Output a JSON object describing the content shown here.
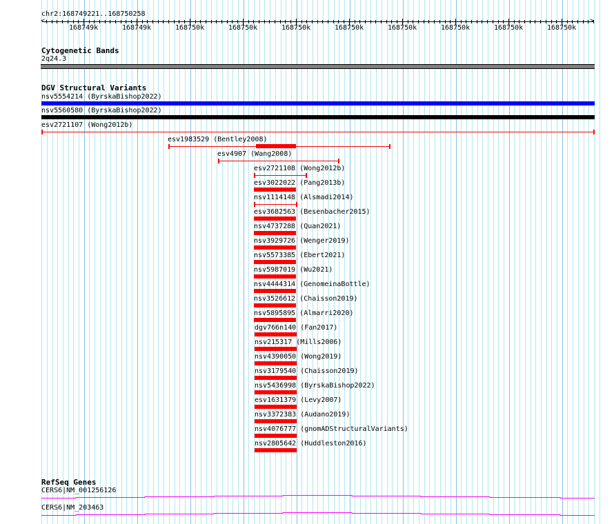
{
  "ruler": {
    "location": "chr2:168749221..168750258",
    "tick_labels": [
      "168749k",
      "168749k",
      "168750k",
      "168750k",
      "168750k",
      "168750k",
      "168750k",
      "168750k",
      "168750k",
      "168750k"
    ]
  },
  "cytobands": {
    "title": "Cytogenetic Bands",
    "band": "2q24.3"
  },
  "dgv": {
    "title": "DGV Structural Variants",
    "variants": [
      {
        "label": "nsv5554214 (ByrskaBishop2022)"
      },
      {
        "label": "nsv5560580 (ByrskaBishop2022)"
      },
      {
        "label": "esv2721107 (Wong2012b)"
      },
      {
        "label": "esv1983529 (Bentley2008)"
      },
      {
        "label": "esv4907 (Wang2008)"
      },
      {
        "label": "esv2721108 (Wong2012b)"
      },
      {
        "label": "esv3022022 (Pang2013b)"
      },
      {
        "label": "nsv1114148 (Alsmadi2014)"
      },
      {
        "label": "esv3682563 (Besenbacher2015)"
      },
      {
        "label": "nsv4737288 (Quan2021)"
      },
      {
        "label": "nsv3929726 (Wenger2019)"
      },
      {
        "label": "nsv5573385 (Ebert2021)"
      },
      {
        "label": "nsv5987019 (Wu2021)"
      },
      {
        "label": "nsv4444314 (GenomeinaBottle)"
      },
      {
        "label": "nsv3526612 (Chaisson2019)"
      },
      {
        "label": "nsv5895895 (Almarri2020)"
      },
      {
        "label": "dgv766n140 (Fan2017)"
      },
      {
        "label": "nsv215317 (Mills2006)"
      },
      {
        "label": "nsv4390050 (Wong2019)"
      },
      {
        "label": "nsv3179540 (Chaisson2019)"
      },
      {
        "label": "nsv5436998 (ByrskaBishop2022)"
      },
      {
        "label": "esv1631379 (Levy2007)"
      },
      {
        "label": "nsv3372383 (Audano2019)"
      },
      {
        "label": "nsv4076777 (gnomADStructuralVariants)"
      },
      {
        "label": "nsv2805642 (Huddleston2016)"
      }
    ]
  },
  "refseq": {
    "title": "RefSeq Genes",
    "genes": [
      {
        "label": "CERS6|NM_001256126"
      },
      {
        "label": "CERS6|NM_203463"
      }
    ]
  },
  "colors": {
    "grid_minor": "#aee8ee",
    "grid_major": "#7fbfe8",
    "variant_red": "#ff0000",
    "variant_blue": "#0000ff",
    "variant_black": "#000000",
    "gene": "#ff00ff",
    "band_gray": "#808080"
  }
}
